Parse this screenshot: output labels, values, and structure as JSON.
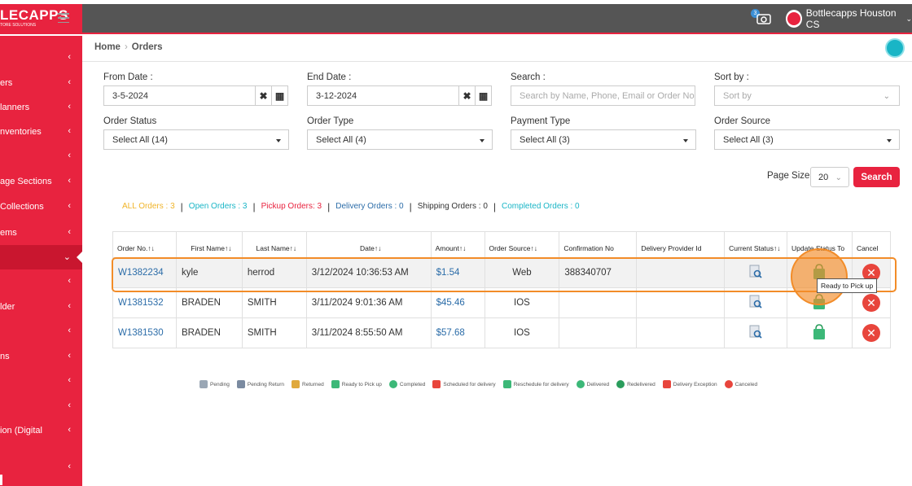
{
  "header": {
    "logo_big": "LECAPPS",
    "logo_small": "TORE SOLUTIONS",
    "notification_count": "3",
    "user_name": "Bottlecapps Houston CS"
  },
  "sidebar": {
    "items": [
      {
        "label": ""
      },
      {
        "label": "ers"
      },
      {
        "label": "lanners"
      },
      {
        "label": "nventories"
      },
      {
        "label": ""
      },
      {
        "label": "age Sections"
      },
      {
        "label": "Collections"
      },
      {
        "label": "ems"
      },
      {
        "label": ""
      },
      {
        "label": ""
      },
      {
        "label": "lder"
      },
      {
        "label": ""
      },
      {
        "label": "ns"
      },
      {
        "label": ""
      },
      {
        "label": ""
      },
      {
        "label": "ion (Digital"
      },
      {
        "label": ""
      }
    ]
  },
  "breadcrumb": {
    "home": "Home",
    "current": "Orders"
  },
  "filters": {
    "from_date_label": "From Date :",
    "from_date": "3-5-2024",
    "end_date_label": "End Date :",
    "end_date": "3-12-2024",
    "search_label": "Search :",
    "search_placeholder": "Search by Name, Phone, Email or Order No",
    "sort_label": "Sort by :",
    "sort_placeholder": "Sort by",
    "order_status_label": "Order Status",
    "order_status": "Select All (14)",
    "order_type_label": "Order Type",
    "order_type": "Select All (4)",
    "payment_type_label": "Payment Type",
    "payment_type": "Select All (3)",
    "order_source_label": "Order Source",
    "order_source": "Select All (3)",
    "page_size_label": "Page Size",
    "page_size": "20",
    "search_button": "Search"
  },
  "counts": {
    "all": "ALL Orders : 3",
    "open": "Open Orders : 3",
    "pickup": "Pickup Orders: 3",
    "delivery": "Delivery Orders : 0",
    "shipping": "Shipping Orders : 0",
    "completed": "Completed Orders : 0",
    "colors": {
      "all": "#f0b429",
      "open": "#19b5c6",
      "pickup": "#e8233f",
      "delivery": "#2b6ca8",
      "shipping": "#333333",
      "completed": "#19b5c6"
    }
  },
  "table": {
    "headers": [
      "Order No.↑↓",
      "First Name↑↓",
      "Last Name↑↓",
      "Date↑↓",
      "Amount↑↓",
      "Order Source↑↓",
      "Confirmation No",
      "Delivery Provider Id",
      "Current Status↑↓",
      "Update Status To",
      "Cancel"
    ],
    "rows": [
      {
        "order_no": "W1382234",
        "first": "kyle",
        "last": "herrod",
        "date": "3/12/2024 10:36:53 AM",
        "amount": "$1.54",
        "source": "Web",
        "confirmation": "388340707",
        "provider": ""
      },
      {
        "order_no": "W1381532",
        "first": "BRADEN",
        "last": "SMITH",
        "date": "3/11/2024 9:01:36 AM",
        "amount": "$45.46",
        "source": "IOS",
        "confirmation": "",
        "provider": ""
      },
      {
        "order_no": "W1381530",
        "first": "BRADEN",
        "last": "SMITH",
        "date": "3/11/2024 8:55:50 AM",
        "amount": "$57.68",
        "source": "IOS",
        "confirmation": "",
        "provider": ""
      }
    ]
  },
  "tooltip": "Ready to Pick up",
  "legend": [
    {
      "label": "Pending",
      "icon": "magnifier-doc-icon",
      "color": "#9aa7b5"
    },
    {
      "label": "Pending Return",
      "icon": "return-doc-icon",
      "color": "#7a8aa0"
    },
    {
      "label": "Returned",
      "icon": "returned-icon",
      "color": "#e0a93c"
    },
    {
      "label": "Ready to Pick up",
      "icon": "bag-icon",
      "color": "#3cb878"
    },
    {
      "label": "Completed",
      "icon": "check-circle-icon",
      "color": "#3cb878"
    },
    {
      "label": "Scheduled for delivery",
      "icon": "delivery-person-icon",
      "color": "#e8453c"
    },
    {
      "label": "Reschedule for delivery",
      "icon": "cart-icon",
      "color": "#3cb878"
    },
    {
      "label": "Delivered",
      "icon": "check-circle-icon",
      "color": "#3cb878"
    },
    {
      "label": "Redelivered",
      "icon": "check-circle-icon",
      "color": "#2a9d5c"
    },
    {
      "label": "Delivery Exception",
      "icon": "delivery-person-icon",
      "color": "#e8453c"
    },
    {
      "label": "Canceled",
      "icon": "x-circle-icon",
      "color": "#e8453c"
    }
  ]
}
